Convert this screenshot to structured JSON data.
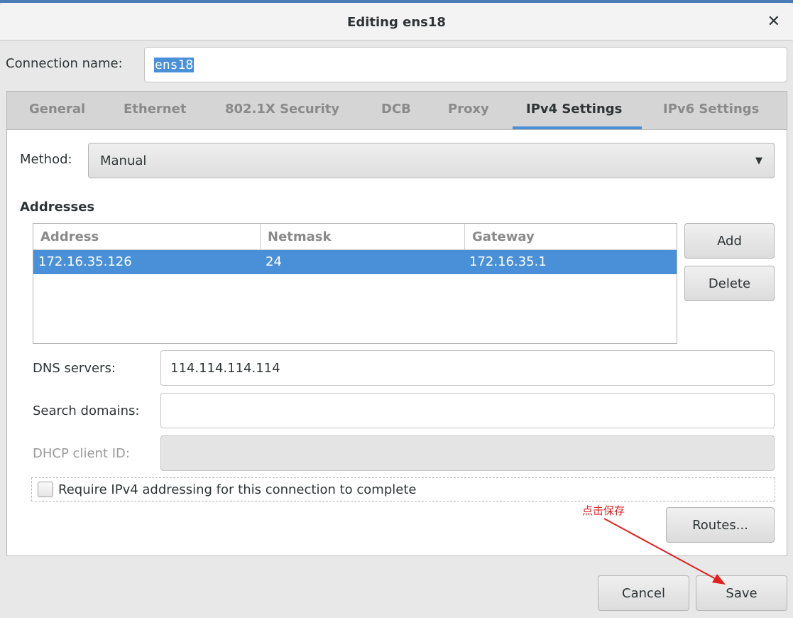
{
  "window": {
    "title": "Editing ens18",
    "close_icon": "close-icon"
  },
  "connection_name": {
    "label": "Connection name:",
    "value": "ens18"
  },
  "tabs": [
    {
      "label": "General"
    },
    {
      "label": "Ethernet"
    },
    {
      "label": "802.1X Security"
    },
    {
      "label": "DCB"
    },
    {
      "label": "Proxy"
    },
    {
      "label": "IPv4 Settings",
      "active": true
    },
    {
      "label": "IPv6 Settings"
    }
  ],
  "method": {
    "label": "Method:",
    "value": "Manual"
  },
  "addresses": {
    "heading": "Addresses",
    "columns": [
      "Address",
      "Netmask",
      "Gateway"
    ],
    "rows": [
      {
        "address": "172.16.35.126",
        "netmask": "24",
        "gateway": "172.16.35.1",
        "selected": true
      }
    ],
    "add_label": "Add",
    "delete_label": "Delete"
  },
  "dns": {
    "label": "DNS servers:",
    "value": "114.114.114.114"
  },
  "search_domains": {
    "label": "Search domains:",
    "value": ""
  },
  "dhcp_client_id": {
    "label": "DHCP client ID:",
    "value": "",
    "disabled": true
  },
  "require_ipv4": {
    "label": "Require IPv4 addressing for this connection to complete",
    "checked": false
  },
  "routes_label": "Routes...",
  "footer": {
    "cancel_label": "Cancel",
    "save_label": "Save"
  },
  "annotation": {
    "text": "点击保存",
    "color": "#e02020"
  },
  "colors": {
    "accent": "#4a90d9"
  }
}
